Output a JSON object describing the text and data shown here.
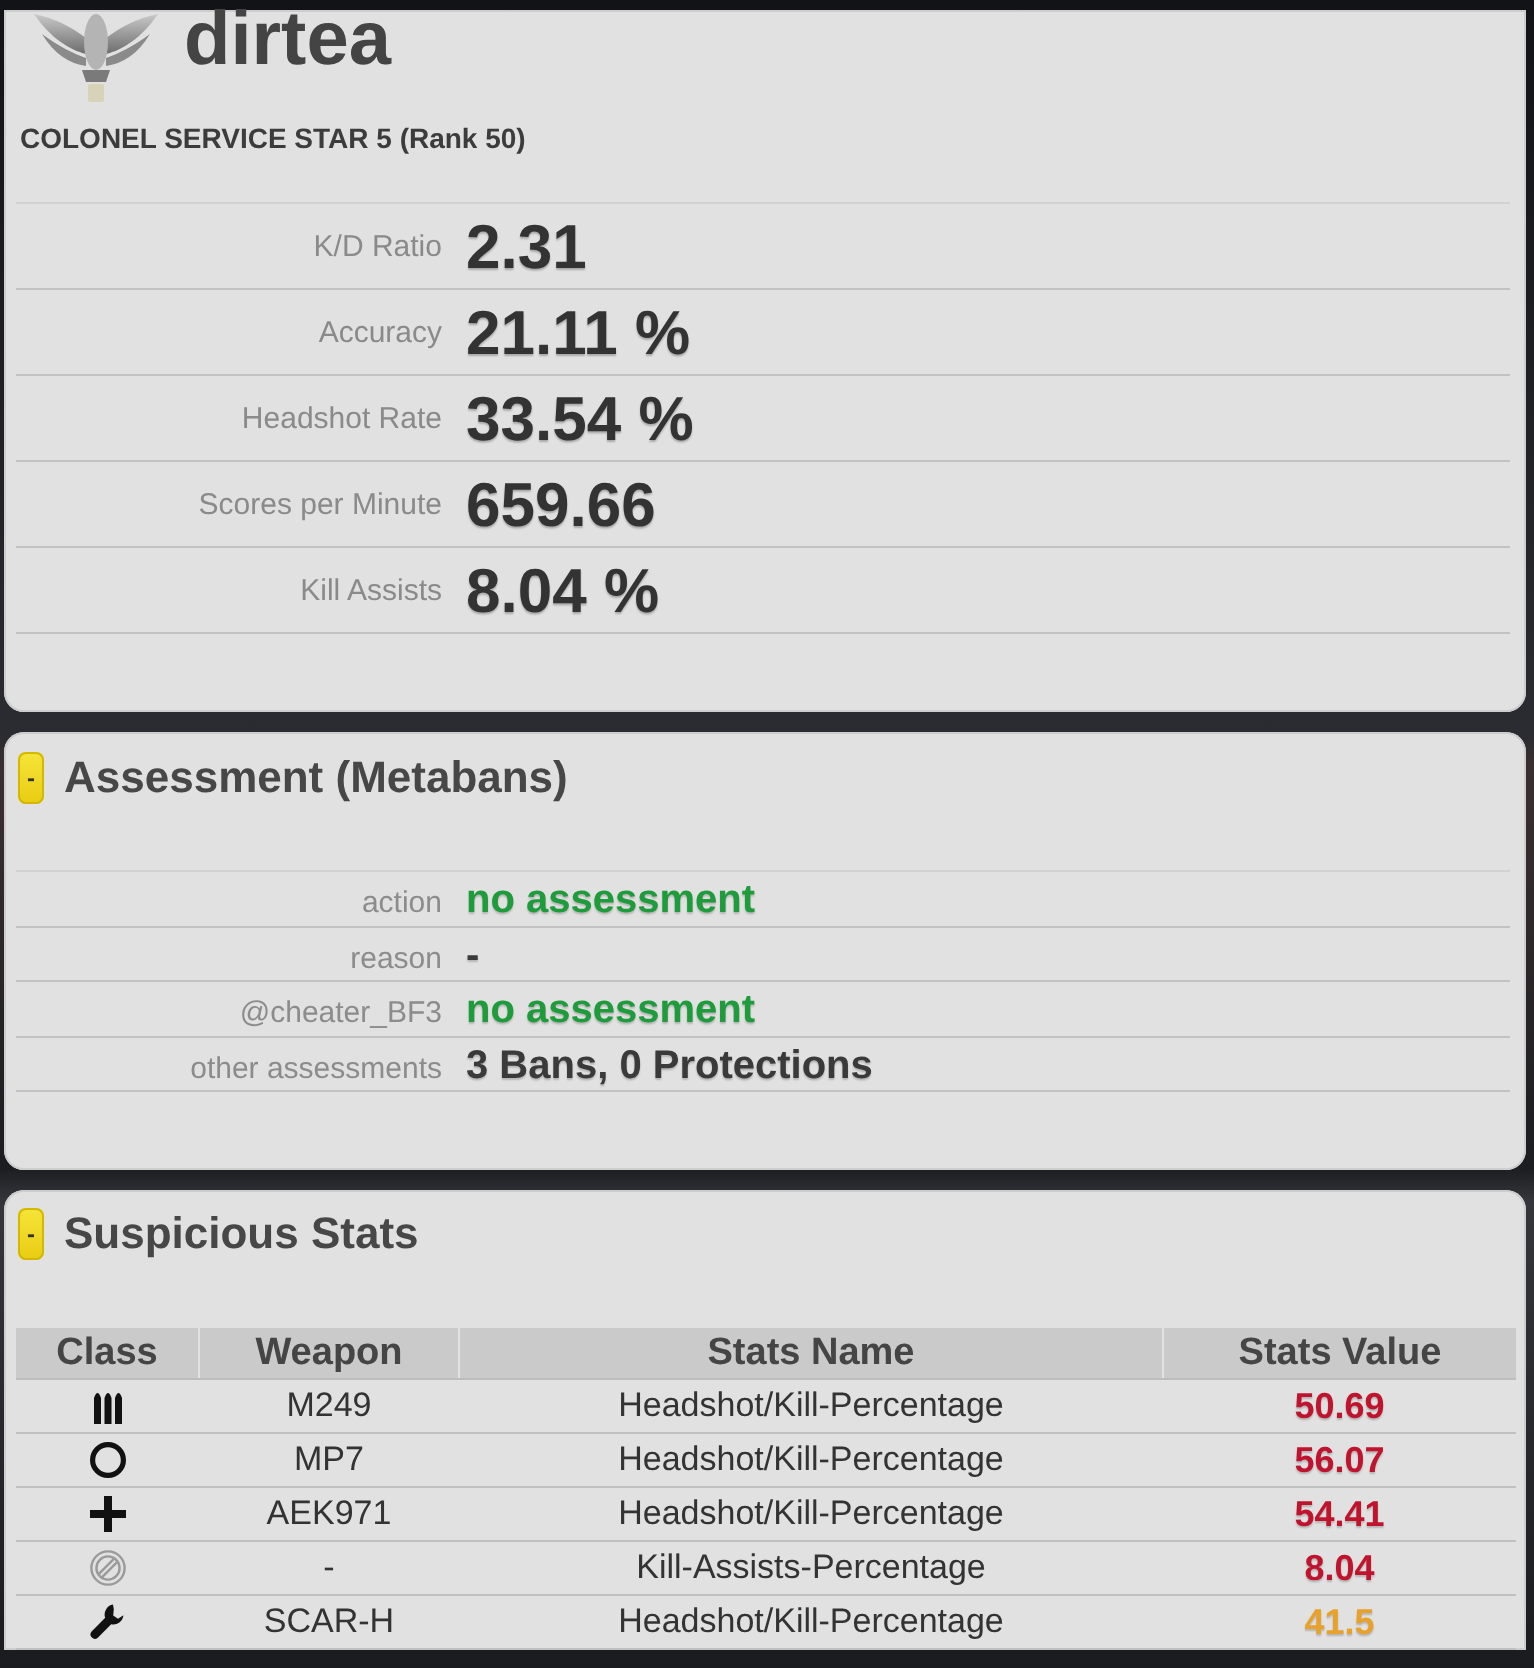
{
  "profile": {
    "name": "dirtea",
    "rank": "COLONEL SERVICE STAR 5 (Rank 50)",
    "stats": [
      {
        "label": "K/D Ratio",
        "value": "2.31"
      },
      {
        "label": "Accuracy",
        "value": "21.11 %"
      },
      {
        "label": "Headshot Rate",
        "value": "33.54 %"
      },
      {
        "label": "Scores per Minute",
        "value": "659.66"
      },
      {
        "label": "Kill Assists",
        "value": "8.04 %"
      }
    ]
  },
  "assessment": {
    "toggle": "-",
    "title": "Assessment (Metabans)",
    "rows": [
      {
        "label": "action",
        "value": "no assessment",
        "color": "#1e9b3a"
      },
      {
        "label": "reason",
        "value": "-",
        "color": "#3a3a3a"
      },
      {
        "label": "@cheater_BF3",
        "value": "no assessment",
        "color": "#1e9b3a"
      },
      {
        "label": "other assessments",
        "value": "3 Bans, 0 Protections",
        "color": "#3a3a3a"
      }
    ]
  },
  "suspicious_stats": {
    "toggle": "-",
    "title": "Suspicious Stats",
    "table": {
      "columns": [
        "Class",
        "Weapon",
        "Stats Name",
        "Stats Value"
      ],
      "rows": [
        {
          "kind": "bullets",
          "weapon": "M249",
          "stats_name": "Headshot/Kill-Percentage",
          "stats_value": "50.69",
          "color": "#c0142e"
        },
        {
          "kind": "ring",
          "weapon": "MP7",
          "stats_name": "Headshot/Kill-Percentage",
          "stats_value": "56.07",
          "color": "#c0142e"
        },
        {
          "kind": "cross",
          "weapon": "AEK971",
          "stats_name": "Headshot/Kill-Percentage",
          "stats_value": "54.41",
          "color": "#c0142e"
        },
        {
          "kind": "slashed",
          "weapon": "-",
          "stats_name": "Kill-Assists-Percentage",
          "stats_value": "8.04",
          "color": "#c0142e"
        },
        {
          "kind": "wrench",
          "weapon": "SCAR-H",
          "stats_name": "Headshot/Kill-Percentage",
          "stats_value": "41.5",
          "color": "#e8a22c"
        }
      ]
    }
  }
}
